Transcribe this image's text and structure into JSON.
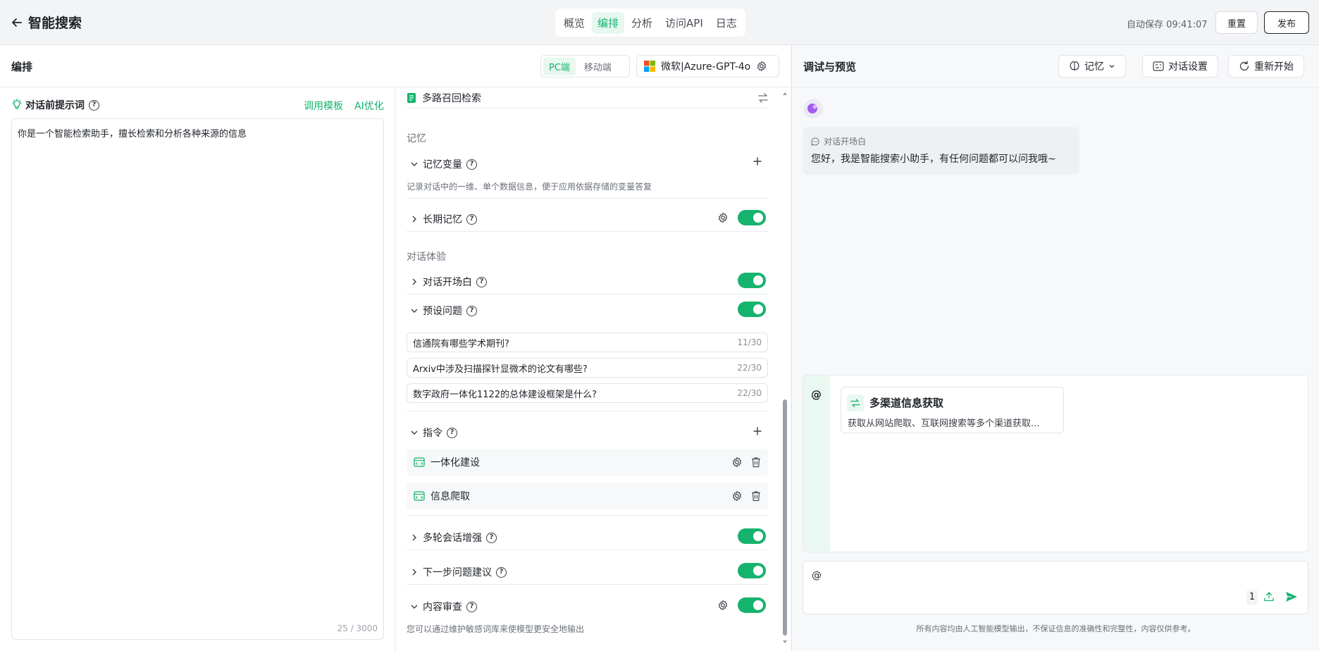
{
  "header": {
    "back_label": "←",
    "title": "智能搜索",
    "tabs": [
      "概览",
      "编排",
      "分析",
      "访问API",
      "日志"
    ],
    "active_tab": "编排",
    "autosave": "自动保存 09:41:07",
    "reset_label": "重置",
    "publish_label": "发布"
  },
  "editor": {
    "title": "编排",
    "platform": {
      "pc": "PC端",
      "mobile": "移动端",
      "active": "PC端"
    },
    "model": "微软|Azure-GPT-4o",
    "prompt": {
      "label": "对话前提示词",
      "template_link": "调用模板",
      "ai_link": "AI优化",
      "text": "你是一个智能检索助手，擅长检索和分析各种来源的信息",
      "count": "25 / 3000"
    }
  },
  "config": {
    "retrieval_item": "多路召回检索",
    "memory_group": "记忆",
    "memory_vars": {
      "label": "记忆变量",
      "note": "记录对话中的一维、单个数据信息，便于应用依据存储的变量答复"
    },
    "long_memory": {
      "label": "长期记忆",
      "enabled": true
    },
    "experience_group": "对话体验",
    "opening": {
      "label": "对话开场白",
      "enabled": true
    },
    "preset": {
      "label": "预设问题",
      "enabled": true,
      "questions": [
        {
          "text": "信通院有哪些学术期刊?",
          "count": "11/30"
        },
        {
          "text": "Arxiv中涉及扫描探针显微术的论文有哪些?",
          "count": "22/30"
        },
        {
          "text": "数字政府一体化1122的总体建设框架是什么?",
          "count": "22/30"
        }
      ]
    },
    "commands": {
      "label": "指令",
      "items": [
        "一体化建设",
        "信息爬取"
      ]
    },
    "multi_turn": {
      "label": "多轮会话增强",
      "enabled": true
    },
    "next_suggest": {
      "label": "下一步问题建议",
      "enabled": true
    },
    "moderation": {
      "label": "内容审查",
      "enabled": true,
      "note": "您可以通过维护敏感词库来使模型更安全地输出"
    }
  },
  "preview": {
    "title": "调试与预览",
    "memory_btn": "记忆",
    "settings_btn": "对话设置",
    "restart_btn": "重新开始",
    "opening_tag": "对话开场白",
    "opening_msg": "您好，我是智能搜索小助手，有任何问题都可以问我哦~",
    "at_symbol": "@",
    "skill": {
      "title": "多渠道信息获取",
      "desc": "获取从网站爬取、互联网搜索等多个渠道获取..."
    },
    "input_value": "@",
    "attach_count": "1",
    "disclaimer": "所有内容均由人工智能模型输出，不保证信息的准确性和完整性，内容仅供参考。"
  },
  "colors": {
    "accent": "#16b36e",
    "accent_bg": "#e8f7ef"
  }
}
